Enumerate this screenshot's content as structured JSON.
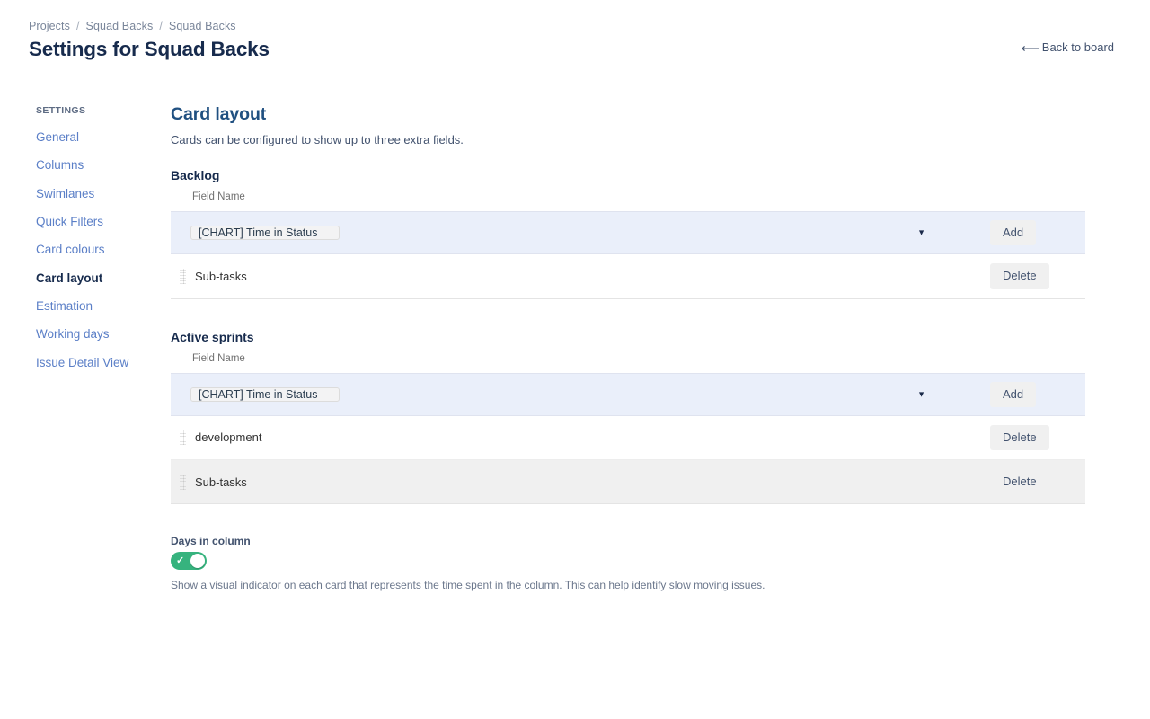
{
  "header": {
    "breadcrumb": [
      "Projects",
      "Squad Backs",
      "Squad Backs"
    ],
    "separator": "/",
    "title": "Settings for Squad Backs",
    "back_link": "Back to board",
    "back_icon": "arrow-left-icon"
  },
  "sidebar": {
    "heading": "SETTINGS",
    "items": [
      {
        "label": "General",
        "active": false
      },
      {
        "label": "Columns",
        "active": false
      },
      {
        "label": "Swimlanes",
        "active": false
      },
      {
        "label": "Quick Filters",
        "active": false
      },
      {
        "label": "Card colours",
        "active": false
      },
      {
        "label": "Card layout",
        "active": true
      },
      {
        "label": "Estimation",
        "active": false
      },
      {
        "label": "Working days",
        "active": false
      },
      {
        "label": "Issue Detail View",
        "active": false
      }
    ]
  },
  "main": {
    "title": "Card layout",
    "description": "Cards can be configured to show up to three extra fields.",
    "column_header": "Field Name",
    "add_label": "Add",
    "delete_label": "Delete",
    "caret_icon": "chevron-down-icon",
    "drag_icon": "drag-handle-icon",
    "sections": [
      {
        "heading": "Backlog",
        "selected_field": "[CHART] Time in Status",
        "rows": [
          {
            "label": "Sub-tasks"
          }
        ]
      },
      {
        "heading": "Active sprints",
        "selected_field": "[CHART] Time in Status",
        "rows": [
          {
            "label": "development"
          },
          {
            "label": "Sub-tasks"
          }
        ]
      }
    ],
    "days_in_column": {
      "label": "Days in column",
      "enabled": true,
      "check_icon": "check-icon",
      "description": "Show a visual indicator on each card that represents the time spent in the column. This can help identify slow moving issues."
    }
  },
  "colors": {
    "accent": "#205081",
    "link": "#5b7fc7",
    "toggle_on": "#36b37e",
    "add_row_bg": "#eaeffa",
    "alt_row_bg": "#f0f0f0"
  }
}
